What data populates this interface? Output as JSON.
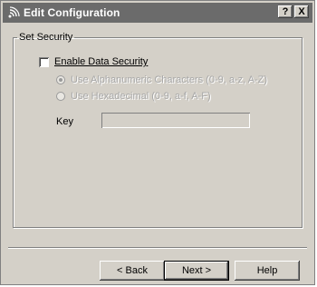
{
  "window": {
    "title": "Edit Configuration",
    "help_button": "?",
    "close_button": "X"
  },
  "security": {
    "group_label": "Set Security",
    "enable_label": "Enable Data Security",
    "enable_checked": false,
    "option_alpha": "Use Alphanumeric Characters (0-9, a-z, A-Z)",
    "option_hex": "Use Hexadecimal (0-9, a-f, A-F)",
    "selected_option": "alphanumeric",
    "key_label": "Key",
    "key_value": ""
  },
  "buttons": {
    "back": "< Back",
    "next": "Next >",
    "help": "Help"
  },
  "colors": {
    "dialog_face": "#d4d0c8",
    "titlebar": "#6b6b6b",
    "disabled_text": "#a8a8a8"
  }
}
